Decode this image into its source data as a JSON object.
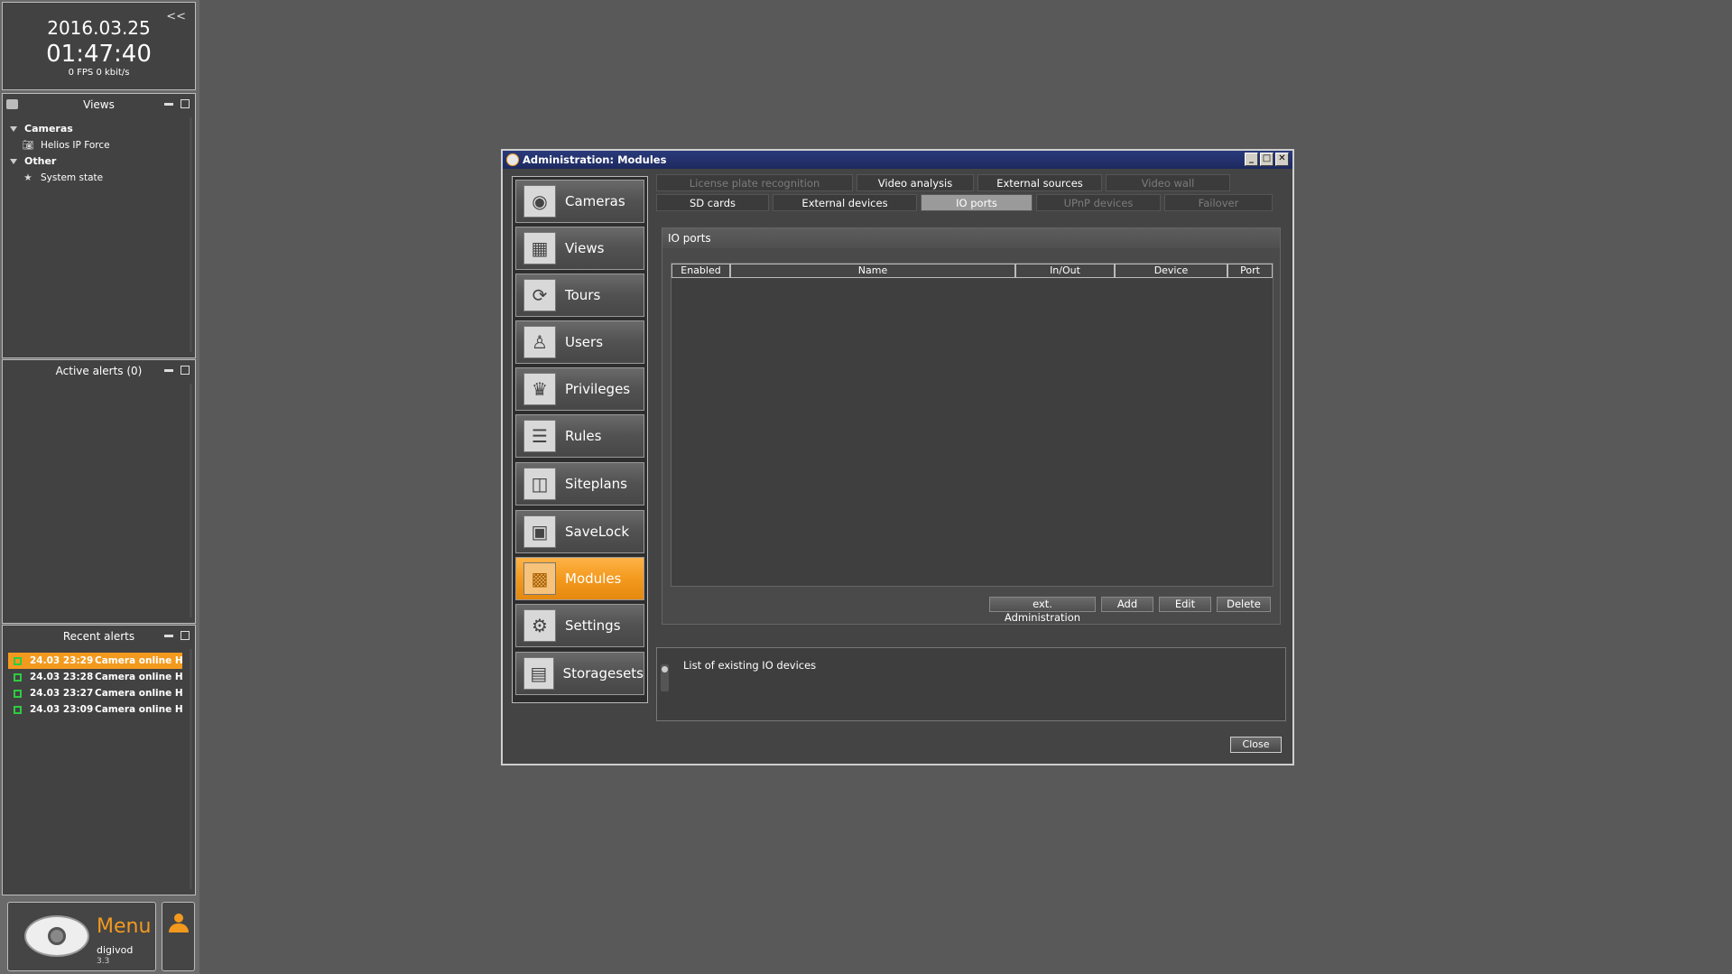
{
  "clock": {
    "date": "2016.03.25",
    "time": "01:47:40",
    "stats": "0 FPS 0 kbit/s",
    "collapse": "<<"
  },
  "views_panel": {
    "title": "Views",
    "tree": [
      {
        "group": "Cameras",
        "items": [
          "Helios IP Force"
        ]
      },
      {
        "group": "Other",
        "items": [
          "System state"
        ]
      }
    ]
  },
  "active_alerts": {
    "title": "Active alerts (0)"
  },
  "recent_alerts": {
    "title": "Recent alerts",
    "rows": [
      {
        "time": "24.03 23:29",
        "text": "Camera online Helic",
        "selected": true
      },
      {
        "time": "24.03 23:28",
        "text": "Camera online Helic"
      },
      {
        "time": "24.03 23:27",
        "text": "Camera online Helic"
      },
      {
        "time": "24.03 23:09",
        "text": "Camera online Helic"
      }
    ]
  },
  "menu": {
    "label": "Menu",
    "brand": "digivod",
    "version": "3.3"
  },
  "dialog": {
    "title": "Administration: Modules",
    "nav": [
      {
        "label": "Cameras",
        "icon": "camera-icon"
      },
      {
        "label": "Views",
        "icon": "grid-icon"
      },
      {
        "label": "Tours",
        "icon": "tour-icon"
      },
      {
        "label": "Users",
        "icon": "user-icon"
      },
      {
        "label": "Privileges",
        "icon": "privileges-icon"
      },
      {
        "label": "Rules",
        "icon": "rules-icon"
      },
      {
        "label": "Siteplans",
        "icon": "siteplan-icon"
      },
      {
        "label": "SaveLock",
        "icon": "lock-icon"
      },
      {
        "label": "Modules",
        "icon": "modules-icon",
        "active": true
      },
      {
        "label": "Settings",
        "icon": "gears-icon"
      },
      {
        "label": "Storagesets",
        "icon": "storage-icon"
      }
    ],
    "tabs_row1": [
      {
        "label": "License plate recognition",
        "disabled": true
      },
      {
        "label": "Video analysis"
      },
      {
        "label": "External sources"
      },
      {
        "label": "Video wall",
        "disabled": true
      }
    ],
    "tabs_row2": [
      {
        "label": "SD cards"
      },
      {
        "label": "External devices"
      },
      {
        "label": "IO ports",
        "selected": true
      },
      {
        "label": "UPnP devices",
        "disabled": true
      },
      {
        "label": "Failover",
        "disabled": true
      }
    ],
    "group_title": "IO ports",
    "columns": [
      "Enabled",
      "Name",
      "In/Out",
      "Device",
      "Port"
    ],
    "buttons": [
      "ext. Administration",
      "Add",
      "Edit",
      "Delete"
    ],
    "description": "List of existing IO devices",
    "close": "Close"
  },
  "colors": {
    "accent": "#f39a1e",
    "background": "#595959",
    "titlebar": "#1d2a60",
    "status_ok": "#2ecc40"
  }
}
